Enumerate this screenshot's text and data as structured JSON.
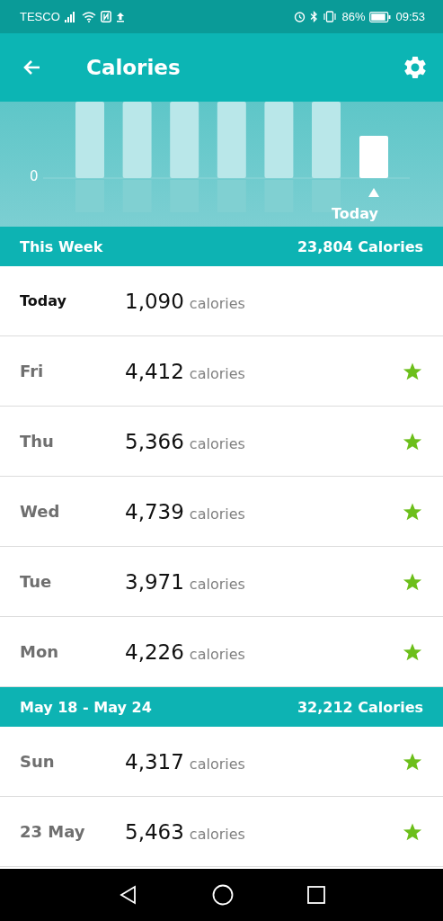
{
  "status_bar": {
    "carrier": "TESCO",
    "battery": "86%",
    "time": "09:53"
  },
  "header": {
    "title": "Calories"
  },
  "chart": {
    "zero_label": "0",
    "today_label": "Today"
  },
  "sections": [
    {
      "title": "This Week",
      "total": "23,804 Calories",
      "rows": [
        {
          "kind": "today",
          "day": "Today",
          "value": "1,090",
          "unit": "calories",
          "starred": false
        },
        {
          "kind": "day",
          "day": "Fri",
          "value": "4,412",
          "unit": "calories",
          "starred": true
        },
        {
          "kind": "day",
          "day": "Thu",
          "value": "5,366",
          "unit": "calories",
          "starred": true
        },
        {
          "kind": "day",
          "day": "Wed",
          "value": "4,739",
          "unit": "calories",
          "starred": true
        },
        {
          "kind": "day",
          "day": "Tue",
          "value": "3,971",
          "unit": "calories",
          "starred": true
        },
        {
          "kind": "day",
          "day": "Mon",
          "value": "4,226",
          "unit": "calories",
          "starred": true
        }
      ]
    },
    {
      "title": "May 18 - May 24",
      "total": "32,212 Calories",
      "rows": [
        {
          "kind": "day",
          "day": "Sun",
          "value": "4,317",
          "unit": "calories",
          "starred": true
        },
        {
          "kind": "day",
          "day": "23 May",
          "value": "5,463",
          "unit": "calories",
          "starred": true
        }
      ]
    }
  ]
}
